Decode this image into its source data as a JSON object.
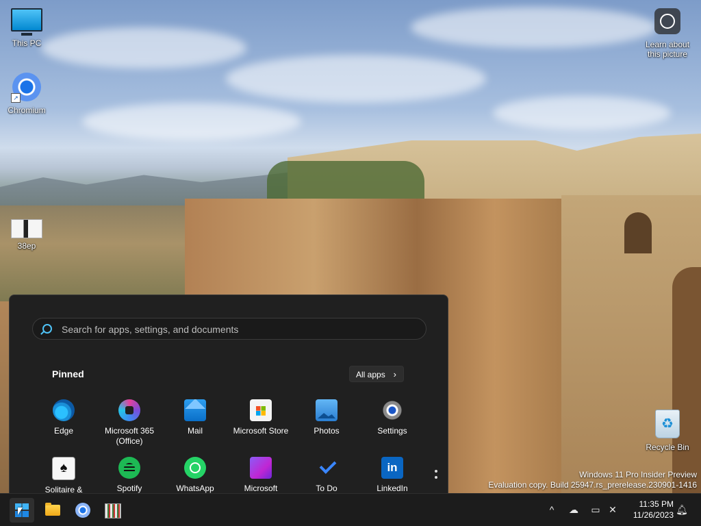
{
  "desktop": {
    "icons": [
      {
        "label": "This PC"
      },
      {
        "label": "Chromium"
      },
      {
        "label": "38ep"
      },
      {
        "label": "Recycle Bin"
      }
    ],
    "learn_about": "Learn about this picture"
  },
  "watermark": {
    "line1": "Windows 11 Pro Insider Preview",
    "line2": "Evaluation copy. Build 25947.rs_prerelease.230901-1416"
  },
  "start_menu": {
    "search_placeholder": "Search for apps, settings, and documents",
    "pinned_title": "Pinned",
    "all_apps_label": "All apps",
    "apps": [
      {
        "label": "Edge",
        "icon": "edge-icon"
      },
      {
        "label": "Microsoft 365 (Office)",
        "icon": "microsoft-365-icon"
      },
      {
        "label": "Mail",
        "icon": "mail-icon"
      },
      {
        "label": "Microsoft Store",
        "icon": "store-icon"
      },
      {
        "label": "Photos",
        "icon": "photos-icon"
      },
      {
        "label": "Settings",
        "icon": "settings-icon"
      },
      {
        "label": "Solitaire &",
        "icon": "solitaire-icon"
      },
      {
        "label": "Spotify",
        "icon": "spotify-icon"
      },
      {
        "label": "WhatsApp",
        "icon": "whatsapp-icon"
      },
      {
        "label": "Microsoft",
        "icon": "clipchamp-icon"
      },
      {
        "label": "To Do",
        "icon": "todo-icon"
      },
      {
        "label": "LinkedIn",
        "icon": "linkedin-icon"
      }
    ]
  },
  "taskbar": {
    "pinned": [
      "start-icon",
      "file-explorer-icon",
      "chromium-icon",
      "app-icon"
    ],
    "tray": [
      "chevron-up-icon",
      "onedrive-offline-icon",
      "network-icon",
      "volume-muted-icon",
      "notification-bell-icon"
    ],
    "time": "11:35 PM",
    "date": "11/26/2023"
  }
}
